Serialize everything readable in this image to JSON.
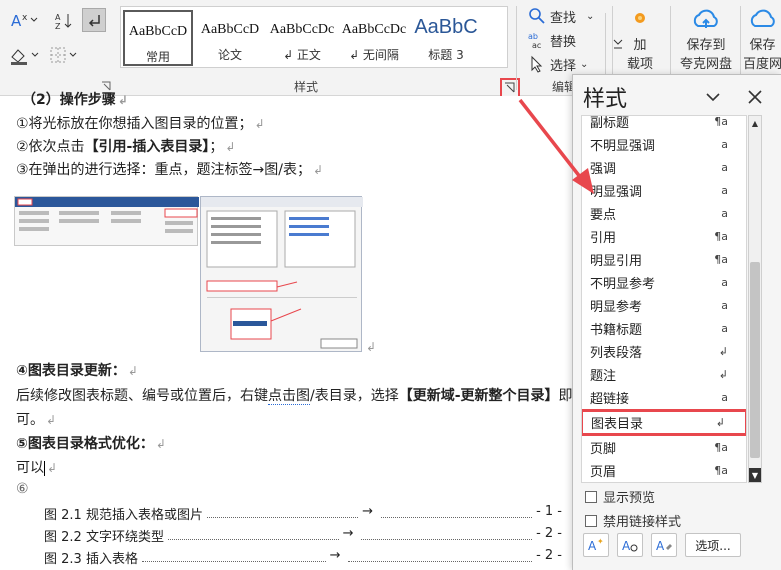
{
  "ribbon": {
    "style_gallery": [
      {
        "sample": "AaBbCcD",
        "name": "常用",
        "selected": true
      },
      {
        "sample": "AaBbCcD",
        "name": "论文"
      },
      {
        "sample": "AaBbCcDc",
        "name": "↲ 正文"
      },
      {
        "sample": "AaBbCcDc",
        "name": "↲ 无间隔"
      },
      {
        "sample": "AaBbC",
        "name": "标题 3"
      }
    ],
    "style_group_label": "样式",
    "edit_group_label": "编辑",
    "find_label": "查找",
    "replace_label": "替换",
    "select_label": "选择",
    "addin_label_1": "加",
    "addin_label_2": "载项",
    "save_cloud_label_1": "保存到",
    "save_cloud_label_2": "夸克网盘",
    "save_baidu_label_1": "保存",
    "save_baidu_label_2": "百度网"
  },
  "document": {
    "heading_steps": "（2）操作步骤",
    "step1": "①将光标放在你想插入图目录的位置；",
    "step2_pre": "②依次点击",
    "step2_bold": "【引用-插入表目录】",
    "step2_post": "；",
    "step3": "③在弹出的进行选择：重点，题注标签→图/表；",
    "section4_title": "④图表目录更新：",
    "section4_body_pre": "后续修改图表标题、编号或位置后，右键",
    "section4_body_link": "点击图",
    "section4_body_mid": "/表目录，选择",
    "section4_body_bold": "【更新域-更新整个目录】",
    "section4_body_post": "即",
    "section4_body_line2": "可。",
    "section5_title": "⑤图表目录格式优化：",
    "section5_body": "可以",
    "section6_marker": "⑥",
    "toc": [
      {
        "title": "图 2.1 规范插入表格或图片",
        "arrow": "→",
        "page": "- 1 -"
      },
      {
        "title": "图 2.2 文字环绕类型",
        "arrow": "→",
        "page": "- 2 -"
      },
      {
        "title": "图 2.3 插入表格",
        "arrow": "→",
        "page": "- 2 -"
      }
    ]
  },
  "styles_pane": {
    "title": "样式",
    "items": [
      {
        "name": "副标题",
        "indicator": "¶a"
      },
      {
        "name": "不明显强调",
        "indicator": "a"
      },
      {
        "name": "强调",
        "indicator": "a"
      },
      {
        "name": "明显强调",
        "indicator": "a"
      },
      {
        "name": "要点",
        "indicator": "a"
      },
      {
        "name": "引用",
        "indicator": "¶a"
      },
      {
        "name": "明显引用",
        "indicator": "¶a"
      },
      {
        "name": "不明显参考",
        "indicator": "a"
      },
      {
        "name": "明显参考",
        "indicator": "a"
      },
      {
        "name": "书籍标题",
        "indicator": "a"
      },
      {
        "name": "列表段落",
        "indicator": "↲"
      },
      {
        "name": "题注",
        "indicator": "↲"
      },
      {
        "name": "超链接",
        "indicator": "a"
      },
      {
        "name": "图表目录",
        "indicator": "↲",
        "highlight": true
      },
      {
        "name": "页脚",
        "indicator": "¶a"
      },
      {
        "name": "页眉",
        "indicator": "¶a"
      }
    ],
    "show_preview_label": "显示预览",
    "disable_linked_label": "禁用链接样式",
    "options_label": "选项..."
  },
  "colors": {
    "callout_red": "#e8474d",
    "accent_blue": "#2b6cd6"
  }
}
